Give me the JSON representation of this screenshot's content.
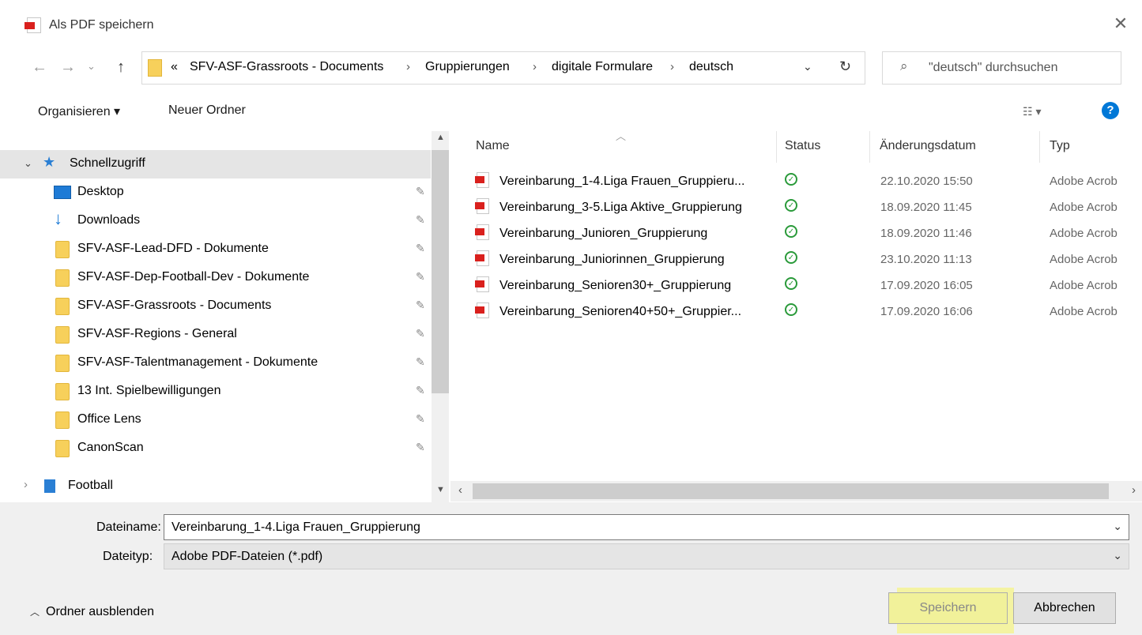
{
  "window": {
    "title": "Als PDF speichern"
  },
  "address": {
    "overflow": "«",
    "crumbs": [
      "SFV-ASF-Grassroots - Documents",
      "Gruppierungen",
      "digitale Formulare",
      "deutsch"
    ],
    "search_placeholder": "\"deutsch\" durchsuchen"
  },
  "toolbar": {
    "organize": "Organisieren ▾",
    "new_folder": "Neuer Ordner"
  },
  "sidebar": {
    "quick_access": "Schnellzugriff",
    "items": [
      {
        "label": "Desktop",
        "icon": "desktop-icon"
      },
      {
        "label": "Downloads",
        "icon": "download-icon"
      },
      {
        "label": "SFV-ASF-Lead-DFD - Dokumente",
        "icon": "folder-icon"
      },
      {
        "label": "SFV-ASF-Dep-Football-Dev - Dokumente",
        "icon": "folder-icon"
      },
      {
        "label": "SFV-ASF-Grassroots - Documents",
        "icon": "folder-icon"
      },
      {
        "label": "SFV-ASF-Regions - General",
        "icon": "folder-icon"
      },
      {
        "label": "SFV-ASF-Talentmanagement - Dokumente",
        "icon": "folder-icon"
      },
      {
        "label": "13 Int. Spielbewilligungen",
        "icon": "folder-icon"
      },
      {
        "label": "Office Lens",
        "icon": "folder-icon"
      },
      {
        "label": "CanonScan",
        "icon": "folder-icon"
      }
    ],
    "football": "Football"
  },
  "columns": {
    "name": "Name",
    "status": "Status",
    "date": "Änderungsdatum",
    "type": "Typ"
  },
  "files": [
    {
      "name": "Vereinbarung_1-4.Liga Frauen_Gruppieru...",
      "date": "22.10.2020 15:50",
      "type": "Adobe Acrob"
    },
    {
      "name": "Vereinbarung_3-5.Liga Aktive_Gruppierung",
      "date": "18.09.2020 11:45",
      "type": "Adobe Acrob"
    },
    {
      "name": "Vereinbarung_Junioren_Gruppierung",
      "date": "18.09.2020 11:46",
      "type": "Adobe Acrob"
    },
    {
      "name": "Vereinbarung_Juniorinnen_Gruppierung",
      "date": "23.10.2020 11:13",
      "type": "Adobe Acrob"
    },
    {
      "name": "Vereinbarung_Senioren30+_Gruppierung",
      "date": "17.09.2020 16:05",
      "type": "Adobe Acrob"
    },
    {
      "name": "Vereinbarung_Senioren40+50+_Gruppier...",
      "date": "17.09.2020 16:06",
      "type": "Adobe Acrob"
    }
  ],
  "form": {
    "filename_label": "Dateiname:",
    "filename_value": "Vereinbarung_1-4.Liga Frauen_Gruppierung",
    "filetype_label": "Dateityp:",
    "filetype_value": "Adobe PDF-Dateien (*.pdf)"
  },
  "buttons": {
    "save": "Speichern",
    "cancel": "Abbrechen",
    "hide_folders": "Ordner ausblenden"
  },
  "colors": {
    "highlight": "#f7f562",
    "pdf_red": "#d9201d",
    "status_green": "#2a9a3a",
    "accent": "#0078d7"
  }
}
